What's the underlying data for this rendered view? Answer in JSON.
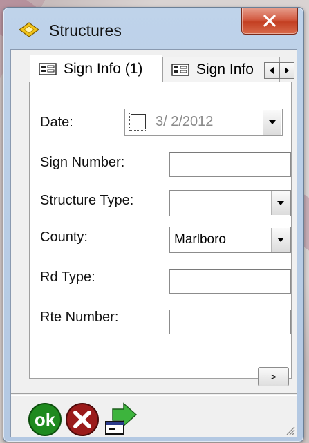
{
  "window": {
    "title": "Structures"
  },
  "tabs": [
    {
      "label": "Sign Info (1)",
      "active": true
    },
    {
      "label": "Sign Info",
      "active": false
    }
  ],
  "form": {
    "date_label": "Date:",
    "date_value": "3/  2/2012",
    "date_checked": false,
    "sign_number_label": "Sign Number:",
    "sign_number_value": "",
    "structure_type_label": "Structure Type:",
    "structure_type_value": "",
    "county_label": "County:",
    "county_value": "Marlboro",
    "rd_type_label": "Rd Type:",
    "rd_type_value": "",
    "rte_number_label": "Rte Number:",
    "rte_number_value": ""
  },
  "buttons": {
    "next_label": ">",
    "ok_label": "ok"
  },
  "icons": {
    "app": "diamond-map-icon",
    "close": "close-x-icon",
    "ok": "ok-circle-icon",
    "cancel": "cancel-circle-icon",
    "export": "green-arrow-export-icon"
  },
  "colors": {
    "ok_green": "#1f8a1f",
    "cancel_red": "#9b1b1b",
    "close_red": "#c94a2f",
    "arrow_green": "#3db43d"
  }
}
